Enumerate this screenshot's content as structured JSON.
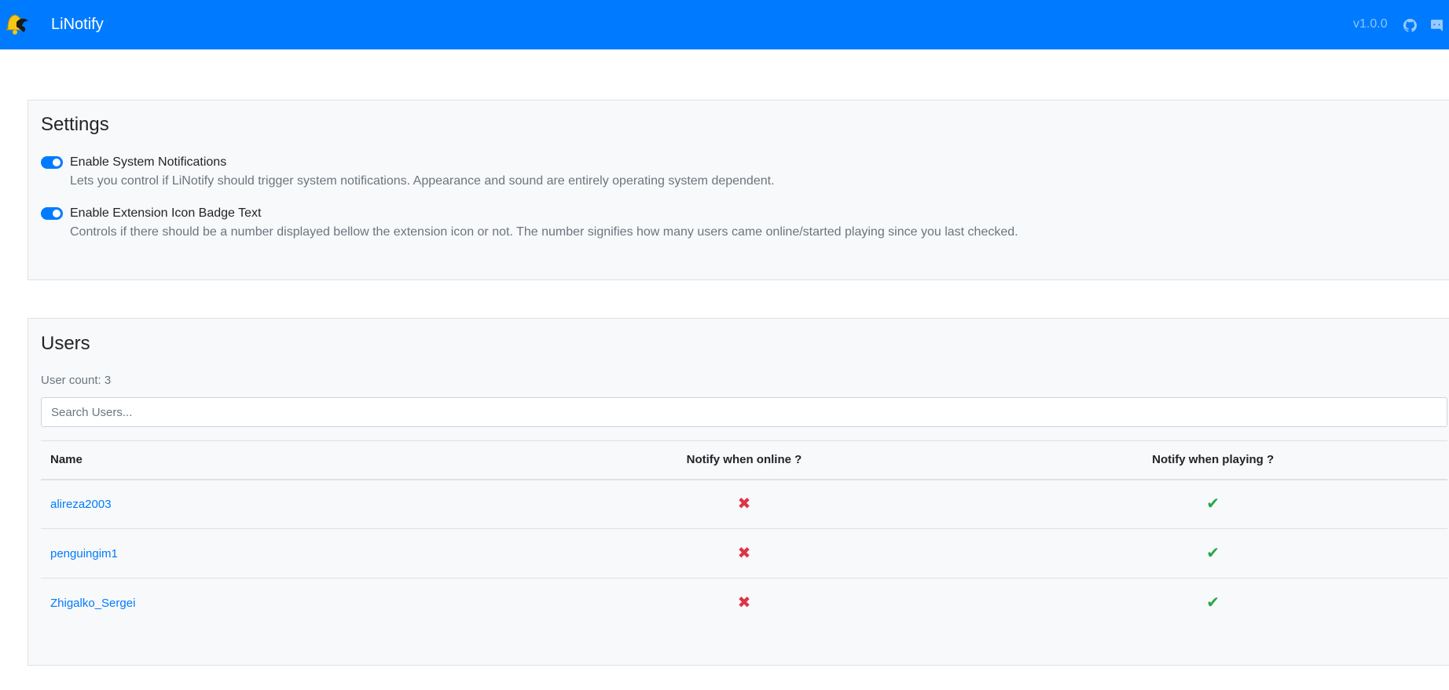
{
  "app": {
    "title": "LiNotify",
    "version": "v1.0.0",
    "icons": {
      "brand": "bell-icon",
      "github": "github-icon",
      "discord": "discord-icon"
    },
    "accent_color": "#007bff"
  },
  "settings": {
    "title": "Settings",
    "items": [
      {
        "label": "Enable System Notifications",
        "description": "Lets you control if LiNotify should trigger system notifications. Appearance and sound are entirely operating system dependent.",
        "enabled": true
      },
      {
        "label": "Enable Extension Icon Badge Text",
        "description": "Controls if there should be a number displayed bellow the extension icon or not. The number signifies how many users came online/started playing since you last checked.",
        "enabled": true
      }
    ]
  },
  "users": {
    "title": "Users",
    "count_label": "User count: 3",
    "search": {
      "placeholder": "Search Users...",
      "value": ""
    },
    "columns": [
      "Name",
      "Notify when online ?",
      "Notify when playing ?"
    ],
    "rows": [
      {
        "name": "alireza2003",
        "notify_online": "✖",
        "notify_playing": "✔"
      },
      {
        "name": "penguingim1",
        "notify_online": "✖",
        "notify_playing": "✔"
      },
      {
        "name": "Zhigalko_Sergei",
        "notify_online": "✖",
        "notify_playing": "✔"
      }
    ],
    "status_colors": {
      "no": "#dc3545",
      "yes": "#28a745"
    }
  }
}
